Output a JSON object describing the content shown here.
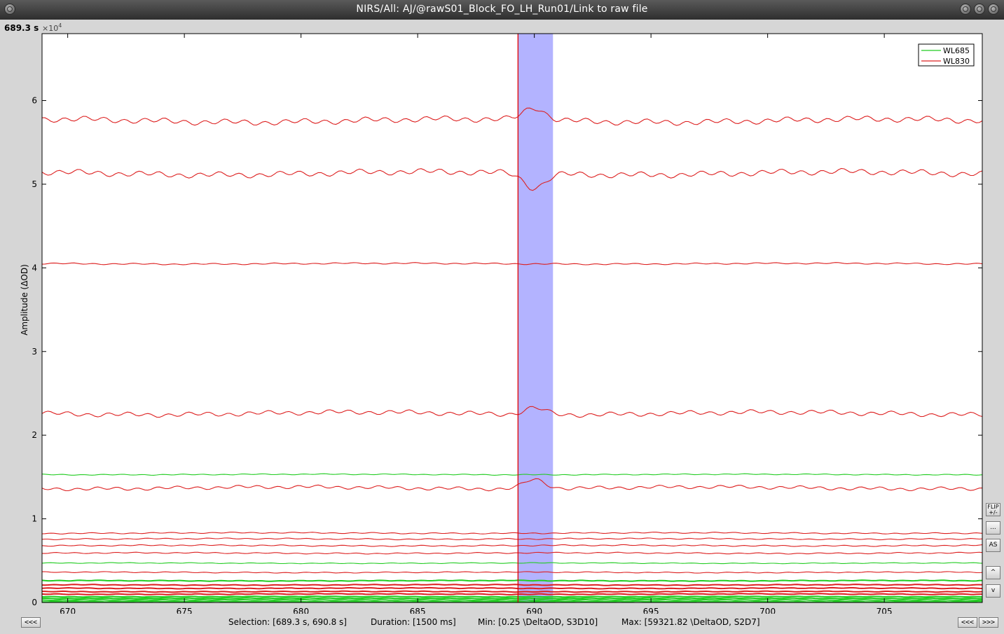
{
  "window": {
    "title": "NIRS/All: AJ/@rawS01_Block_FO_LH_Run01/Link to raw file"
  },
  "current_time": "689.3 s",
  "side_buttons": {
    "flip": "FLIP\n+/-",
    "more": "...",
    "autoscale": "AS",
    "up": "^",
    "down": "v"
  },
  "nav": {
    "prev_label": "<<<",
    "back_label": "<<<",
    "next_label": ">>>"
  },
  "status": {
    "selection": "Selection: [689.3 s, 690.8 s]",
    "duration": "Duration: [1500 ms]",
    "min": "Min: [0.25 \\DeltaOD, S3D10]",
    "max": "Max: [59321.82 \\DeltaOD, S2D7]"
  },
  "colors": {
    "wl685": "#22cc22",
    "wl830": "#dd2020",
    "selection_fill": "#b3b3ff",
    "cursor": "#e00000"
  },
  "chart_data": {
    "type": "line",
    "ylabel": "Amplitude (ΔOD)",
    "y_exponent_label": "×10",
    "y_exponent_power": "4",
    "xlim": [
      668.9,
      709.2
    ],
    "ylim": [
      0,
      6.8
    ],
    "x_ticks": [
      670,
      675,
      680,
      685,
      690,
      695,
      700,
      705
    ],
    "y_ticks": [
      0,
      1,
      2,
      3,
      4,
      5,
      6
    ],
    "grid": false,
    "legend": {
      "position": "top-right",
      "entries": [
        "WL685",
        "WL830"
      ]
    },
    "selection": [
      689.3,
      690.8
    ],
    "cursor_x": 689.3,
    "series": [
      {
        "name": "WL830",
        "level": 5.76,
        "ripple": 0.025,
        "event": 0.15
      },
      {
        "name": "WL830",
        "level": 5.13,
        "ripple": 0.025,
        "event": -0.17
      },
      {
        "name": "WL830",
        "level": 4.05,
        "ripple": 0.006,
        "event": 0.0
      },
      {
        "name": "WL830",
        "level": 2.26,
        "ripple": 0.02,
        "event": 0.08
      },
      {
        "name": "WL685",
        "level": 1.53,
        "ripple": 0.004,
        "event": 0.0
      },
      {
        "name": "WL830",
        "level": 1.37,
        "ripple": 0.015,
        "event": 0.11
      },
      {
        "name": "WL830",
        "level": 0.83,
        "ripple": 0.005,
        "event": 0.0
      },
      {
        "name": "WL830",
        "level": 0.76,
        "ripple": 0.005,
        "event": 0.0
      },
      {
        "name": "WL830",
        "level": 0.68,
        "ripple": 0.005,
        "event": 0.0
      },
      {
        "name": "WL830",
        "level": 0.59,
        "ripple": 0.005,
        "event": 0.0
      },
      {
        "name": "WL685",
        "level": 0.47,
        "ripple": 0.003,
        "event": 0.0
      },
      {
        "name": "WL830",
        "level": 0.36,
        "ripple": 0.004,
        "event": 0.0
      },
      {
        "name": "WL685",
        "level": 0.26,
        "ripple": 0.003,
        "event": 0.0
      },
      {
        "name": "WL830",
        "level": 0.21,
        "ripple": 0.003,
        "event": 0.0
      },
      {
        "name": "WL830",
        "level": 0.17,
        "ripple": 0.003,
        "event": 0.0
      },
      {
        "name": "WL830",
        "level": 0.13,
        "ripple": 0.003,
        "event": 0.0
      },
      {
        "name": "WL830",
        "level": 0.1,
        "ripple": 0.003,
        "event": 0.0
      },
      {
        "name": "WL685",
        "level": 0.07,
        "ripple": 0.002,
        "event": 0.0
      },
      {
        "name": "WL685",
        "level": 0.05,
        "ripple": 0.002,
        "event": 0.0
      },
      {
        "name": "WL685",
        "level": 0.03,
        "ripple": 0.002,
        "event": 0.0
      },
      {
        "name": "WL685",
        "level": 0.01,
        "ripple": 0.002,
        "event": 0.0
      }
    ]
  }
}
